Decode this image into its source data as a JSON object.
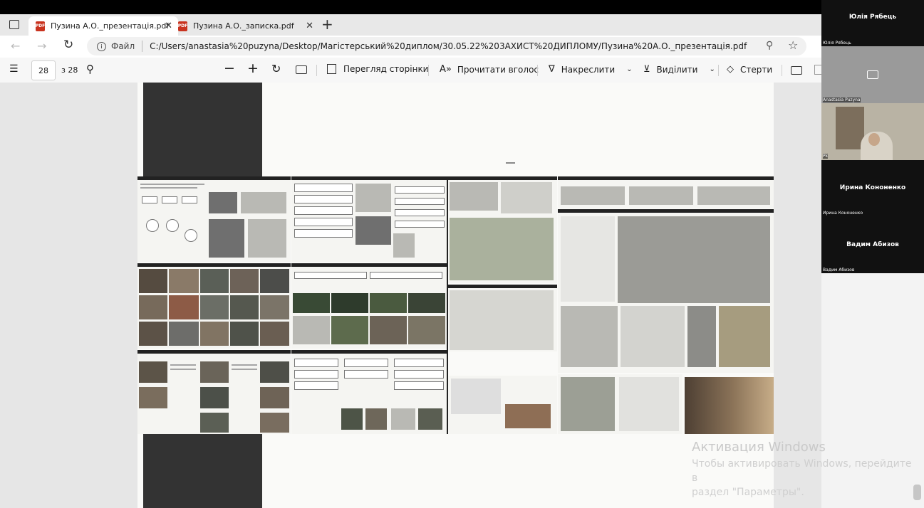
{
  "browser": {
    "tabs": [
      {
        "label": "Пузина А.О._презентація.pdf",
        "active": true,
        "icon": "pdf-icon"
      },
      {
        "label": "Пузина А.О._записка.pdf",
        "active": false,
        "icon": "pdf-icon"
      }
    ],
    "new_tab": "+",
    "file_label": "Файл",
    "url": "C:/Users/anastasia%20puzyna/Desktop/Магістерський%20диплом/30.05.22%203АХИСТ%20ДИПЛОМУ/Пузина%20А.О._презентація.pdf"
  },
  "pdf_toolbar": {
    "page_number": "28",
    "page_total": "з 28",
    "page_view": "Перегляд сторінки",
    "read_aloud": "Прочитати вголос",
    "draw": "Накреслити",
    "highlight": "Виділити",
    "erase": "Стерти"
  },
  "watermark": {
    "title": "Активация Windows",
    "line1": "Чтобы активировать Windows, перейдите в",
    "line2": "раздел \"Параметры\"."
  },
  "participants": [
    {
      "name": "Юлія Рябець",
      "small": "Юлія Рябець"
    },
    {
      "name": "",
      "small": "Anastasia Puzyna"
    },
    {
      "name": "",
      "small": "Рk"
    },
    {
      "name": "Ирина Кононенко",
      "small": "Ирина Кононенко"
    },
    {
      "name": "Вадим Абизов",
      "small": "Вадим Абизов"
    }
  ],
  "colors": {
    "pdf_red": "#c9331f",
    "toolbar_bg": "#f7f7f7",
    "video_bg": "#1e1e1e"
  }
}
